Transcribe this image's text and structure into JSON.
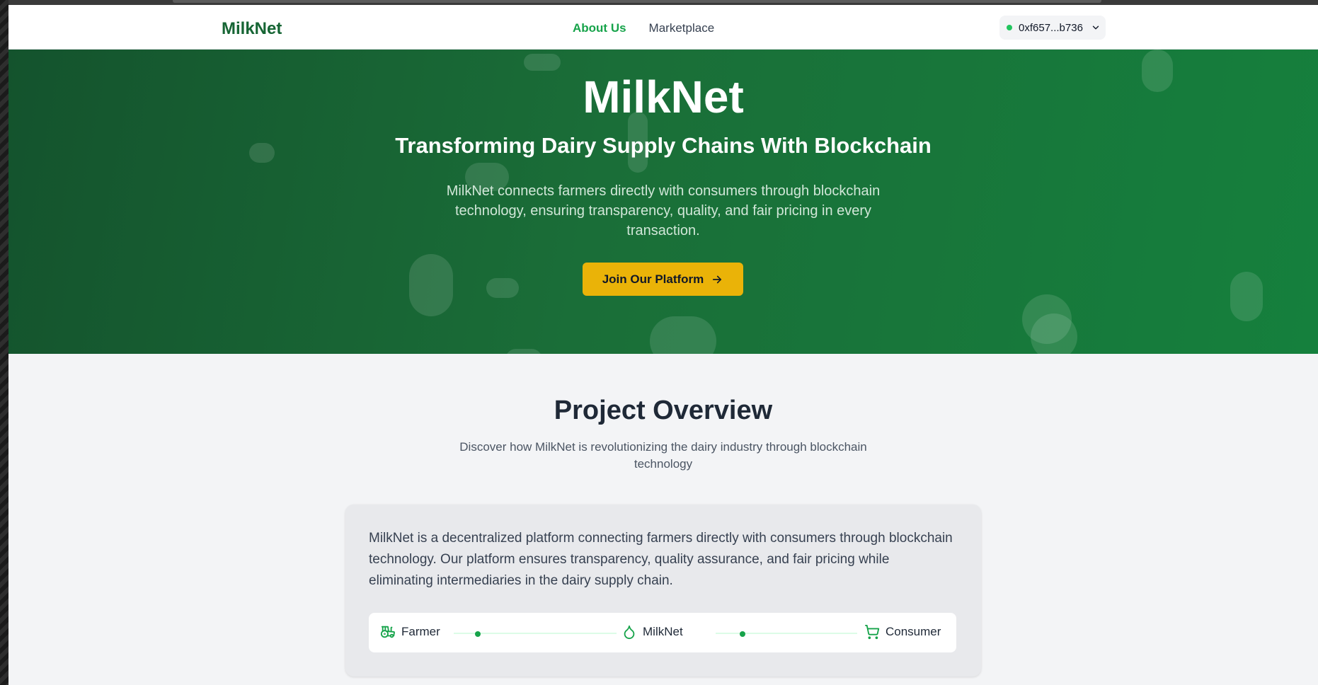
{
  "navbar": {
    "brand": "MilkNet",
    "links": [
      "About Us",
      "Marketplace"
    ],
    "wallet_address": "0xf657...b736"
  },
  "hero": {
    "title": "MilkNet",
    "subtitle": "Transforming Dairy Supply Chains With Blockchain",
    "description": "MilkNet connects farmers directly with consumers through blockchain technology, ensuring transparency, quality, and fair pricing in every transaction.",
    "cta_label": "Join Our Platform"
  },
  "overview": {
    "title": "Project Overview",
    "subtitle": "Discover how MilkNet is revolutionizing the dairy industry through blockchain technology",
    "body": "MilkNet is a decentralized platform connecting farmers directly with consumers through blockchain technology. Our platform ensures transparency, quality assurance, and fair pricing while eliminating intermediaries in the dairy supply chain.",
    "flow": [
      {
        "label": "Farmer",
        "icon": "tractor-icon"
      },
      {
        "label": "MilkNet",
        "icon": "droplet-icon"
      },
      {
        "label": "Consumer",
        "icon": "cart-icon"
      }
    ]
  },
  "colors": {
    "brand_green": "#166534",
    "accent_green": "#16a34a",
    "cta_yellow": "#eab308",
    "status_dot": "#22c55e"
  }
}
